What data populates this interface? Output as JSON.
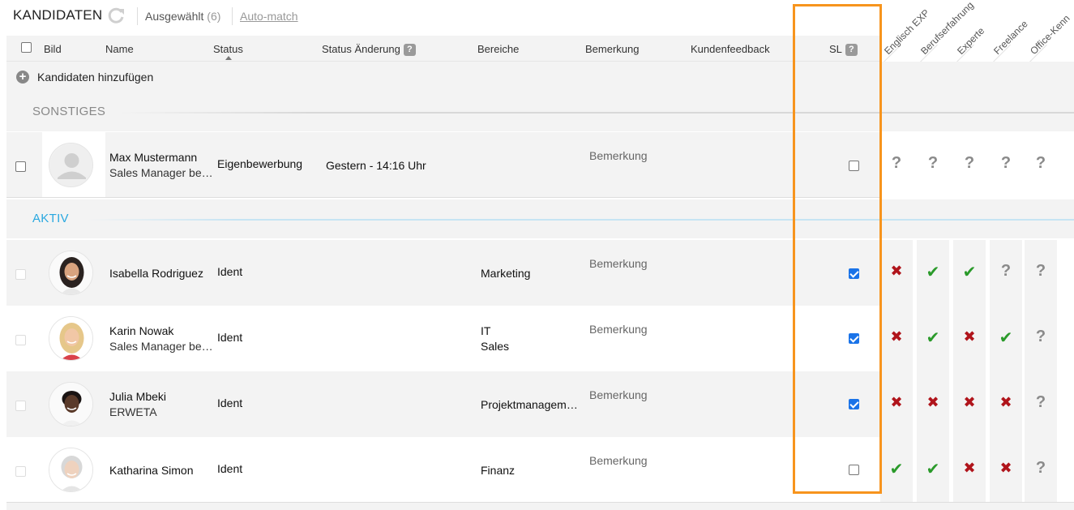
{
  "toolbar": {
    "title": "KANDIDATEN",
    "selected_label": "Ausgewählt",
    "selected_count": "(6)",
    "automatch_label": "Auto-match"
  },
  "columns": {
    "bild": "Bild",
    "name": "Name",
    "status": "Status",
    "status_change": "Status Änderung",
    "bereiche": "Bereiche",
    "bemerkung": "Bemerkung",
    "kundenfeedback": "Kundenfeedback",
    "sl": "SL",
    "help_glyph": "?"
  },
  "criteria_headers": [
    "Englisch EXP",
    "Berufserfahrung",
    "Experte",
    "Freelance",
    "Office-Kenn"
  ],
  "add_candidates_label": "Kandidaten hinzufügen",
  "sections": {
    "sonstiges": "SONSTIGES",
    "aktiv": "AKTIV"
  },
  "candidates": [
    {
      "name": "Max Mustermann",
      "subtitle": "Sales Manager be…",
      "status": "Eigenbewerbung",
      "status_change": "Gestern - 14:16 Uhr",
      "bereiche": [],
      "bemerkung": "Bemerkung",
      "sl_checked": false,
      "criteria": [
        "unknown",
        "unknown",
        "unknown",
        "unknown",
        "unknown"
      ]
    },
    {
      "name": "Isabella Rodriguez",
      "subtitle": "",
      "status": "Ident",
      "status_change": "",
      "bereiche": [
        "Marketing"
      ],
      "bemerkung": "Bemerkung",
      "sl_checked": true,
      "criteria": [
        "no",
        "yes",
        "yes",
        "unknown",
        "unknown"
      ]
    },
    {
      "name": "Karin Nowak",
      "subtitle": "Sales Manager be…",
      "status": "Ident",
      "status_change": "",
      "bereiche": [
        "IT",
        "Sales"
      ],
      "bemerkung": "Bemerkung",
      "sl_checked": true,
      "criteria": [
        "no",
        "yes",
        "no",
        "yes",
        "unknown"
      ]
    },
    {
      "name": "Julia Mbeki",
      "subtitle": "ERWETA",
      "status": "Ident",
      "status_change": "",
      "bereiche": [
        "Projektmanagem…"
      ],
      "bemerkung": "Bemerkung",
      "sl_checked": true,
      "criteria": [
        "no",
        "no",
        "no",
        "no",
        "unknown"
      ]
    },
    {
      "name": "Katharina Simon",
      "subtitle": "",
      "status": "Ident",
      "status_change": "",
      "bereiche": [
        "Finanz"
      ],
      "bemerkung": "Bemerkung",
      "sl_checked": false,
      "criteria": [
        "yes",
        "yes",
        "no",
        "no",
        "unknown"
      ]
    }
  ],
  "colors": {
    "accent_blue": "#29a8e0",
    "highlight_orange": "#f7941d",
    "check_green": "#2a9a2a",
    "cross_red": "#b0141b"
  }
}
